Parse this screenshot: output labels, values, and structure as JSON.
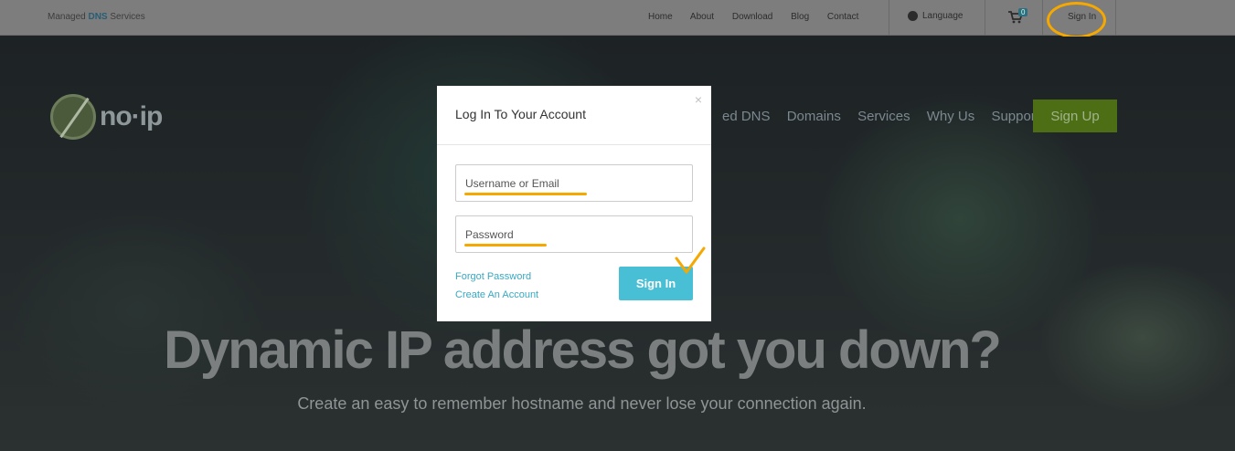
{
  "topbar": {
    "tagline_prefix": "Managed",
    "tagline_brand": "DNS",
    "tagline_suffix": "Services",
    "nav": [
      "Home",
      "About",
      "Download",
      "Blog",
      "Contact"
    ],
    "language": "Language",
    "cart_count": "0",
    "sign_in": "Sign In"
  },
  "header": {
    "logo_text": "no·ip",
    "nav": [
      "ed DNS",
      "Domains",
      "Services",
      "Why Us",
      "Support"
    ],
    "sign_up": "Sign Up"
  },
  "hero": {
    "headline": "Dynamic IP address got you down?",
    "subline": "Create an easy to remember hostname and never lose your connection again."
  },
  "modal": {
    "title": "Log In To Your Account",
    "close": "×",
    "username_placeholder": "Username or Email",
    "password_placeholder": "Password",
    "forgot_password": "Forgot Password",
    "create_account": "Create An Account",
    "sign_in": "Sign In"
  },
  "colors": {
    "annotation": "#f5a800",
    "sign_in_button": "#49bfd5",
    "sign_up_button": "#4e6e16",
    "link": "#3aa8c1"
  }
}
